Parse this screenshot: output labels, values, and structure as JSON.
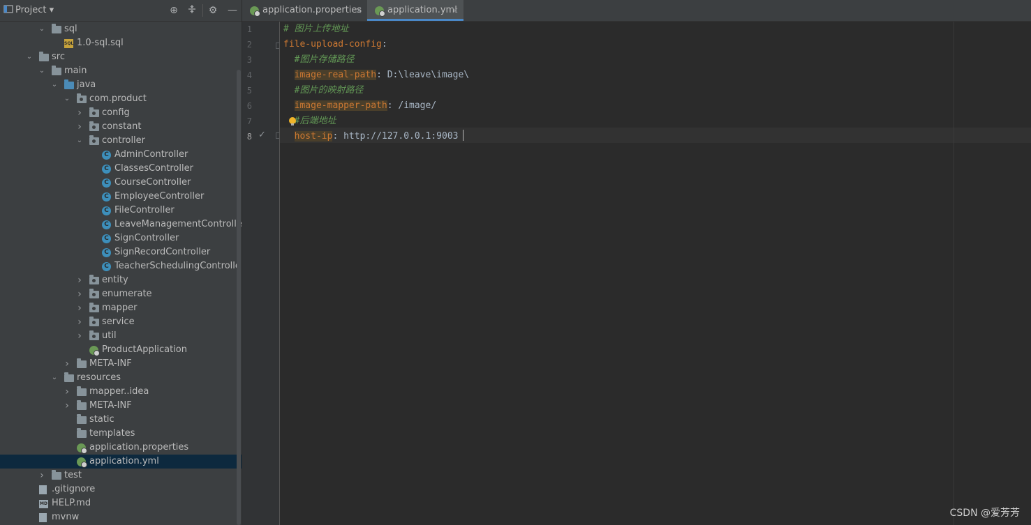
{
  "project_panel": {
    "title": "Project",
    "toolbar_icons": [
      "locate-icon",
      "collapse-all-icon",
      "gear-icon",
      "minimize-icon"
    ],
    "tree": [
      {
        "label": "sql",
        "type": "folder",
        "depth": 2,
        "expanded": true
      },
      {
        "label": "1.0-sql.sql",
        "type": "sql",
        "depth": 3
      },
      {
        "label": "src",
        "type": "folder",
        "depth": 1,
        "expanded": true
      },
      {
        "label": "main",
        "type": "folder",
        "depth": 2,
        "expanded": true
      },
      {
        "label": "java",
        "type": "source-folder",
        "depth": 3,
        "expanded": true
      },
      {
        "label": "com.product",
        "type": "package",
        "depth": 4,
        "expanded": true
      },
      {
        "label": "config",
        "type": "package",
        "depth": 5,
        "expanded": false
      },
      {
        "label": "constant",
        "type": "package",
        "depth": 5,
        "expanded": false
      },
      {
        "label": "controller",
        "type": "package",
        "depth": 5,
        "expanded": true
      },
      {
        "label": "AdminController",
        "type": "class",
        "depth": 6
      },
      {
        "label": "ClassesController",
        "type": "class",
        "depth": 6
      },
      {
        "label": "CourseController",
        "type": "class",
        "depth": 6
      },
      {
        "label": "EmployeeController",
        "type": "class",
        "depth": 6
      },
      {
        "label": "FileController",
        "type": "class",
        "depth": 6
      },
      {
        "label": "LeaveManagementController",
        "type": "class",
        "depth": 6
      },
      {
        "label": "SignController",
        "type": "class",
        "depth": 6
      },
      {
        "label": "SignRecordController",
        "type": "class",
        "depth": 6
      },
      {
        "label": "TeacherSchedulingController",
        "type": "class",
        "depth": 6
      },
      {
        "label": "entity",
        "type": "package",
        "depth": 5,
        "expanded": false
      },
      {
        "label": "enumerate",
        "type": "package",
        "depth": 5,
        "expanded": false
      },
      {
        "label": "mapper",
        "type": "package",
        "depth": 5,
        "expanded": false
      },
      {
        "label": "service",
        "type": "package",
        "depth": 5,
        "expanded": false
      },
      {
        "label": "util",
        "type": "package",
        "depth": 5,
        "expanded": false
      },
      {
        "label": "ProductApplication",
        "type": "spring",
        "depth": 5
      },
      {
        "label": "META-INF",
        "type": "folder",
        "depth": 4,
        "expanded": false
      },
      {
        "label": "resources",
        "type": "folder",
        "depth": 3,
        "expanded": true
      },
      {
        "label": "mapper..idea",
        "type": "folder",
        "depth": 4,
        "expanded": false
      },
      {
        "label": "META-INF",
        "type": "folder",
        "depth": 4,
        "expanded": false
      },
      {
        "label": "static",
        "type": "folder",
        "depth": 4
      },
      {
        "label": "templates",
        "type": "folder",
        "depth": 4
      },
      {
        "label": "application.properties",
        "type": "spring",
        "depth": 4
      },
      {
        "label": "application.yml",
        "type": "spring",
        "depth": 4,
        "selected": true
      },
      {
        "label": "test",
        "type": "folder",
        "depth": 2,
        "expanded": false
      },
      {
        "label": ".gitignore",
        "type": "file",
        "depth": 1
      },
      {
        "label": "HELP.md",
        "type": "md",
        "depth": 1
      },
      {
        "label": "mvnw",
        "type": "file",
        "depth": 1
      }
    ]
  },
  "tabs": [
    {
      "label": "application.properties",
      "active": false,
      "close": "×"
    },
    {
      "label": "application.yml",
      "active": true,
      "close": "×"
    }
  ],
  "editor": {
    "line_numbers": [
      "1",
      "2",
      "3",
      "4",
      "5",
      "6",
      "7",
      "8"
    ],
    "current_line": "8",
    "lines": [
      [
        {
          "t": "# 图片上传地址",
          "c": "cm"
        }
      ],
      [
        {
          "t": "file-upload-config",
          "c": "key"
        },
        {
          "t": ":",
          "c": "val"
        }
      ],
      [
        {
          "t": "  ",
          "c": "val"
        },
        {
          "t": "#图片存储路径",
          "c": "cm"
        }
      ],
      [
        {
          "t": "  ",
          "c": "val"
        },
        {
          "t": "image-real-path",
          "c": "keyhl"
        },
        {
          "t": ": D:\\leave\\image\\",
          "c": "val"
        }
      ],
      [
        {
          "t": "  ",
          "c": "val"
        },
        {
          "t": "#图片的映射路径",
          "c": "cm"
        }
      ],
      [
        {
          "t": "  ",
          "c": "val"
        },
        {
          "t": "image-mapper-path",
          "c": "keyhl"
        },
        {
          "t": ": /image/",
          "c": "val"
        }
      ],
      [
        {
          "t": "  ",
          "c": "val"
        },
        {
          "t": "#后端地址",
          "c": "cm"
        }
      ],
      [
        {
          "t": "  ",
          "c": "val"
        },
        {
          "t": "host-ip",
          "c": "keyhl"
        },
        {
          "t": ": http://127.0.0.1:9003",
          "c": "val"
        }
      ]
    ]
  },
  "watermark": "CSDN @爱芳芳",
  "colors": {
    "accent": "#4a88c7",
    "selection": "#0d293e",
    "keyword": "#cc7832",
    "comment": "#629755"
  }
}
